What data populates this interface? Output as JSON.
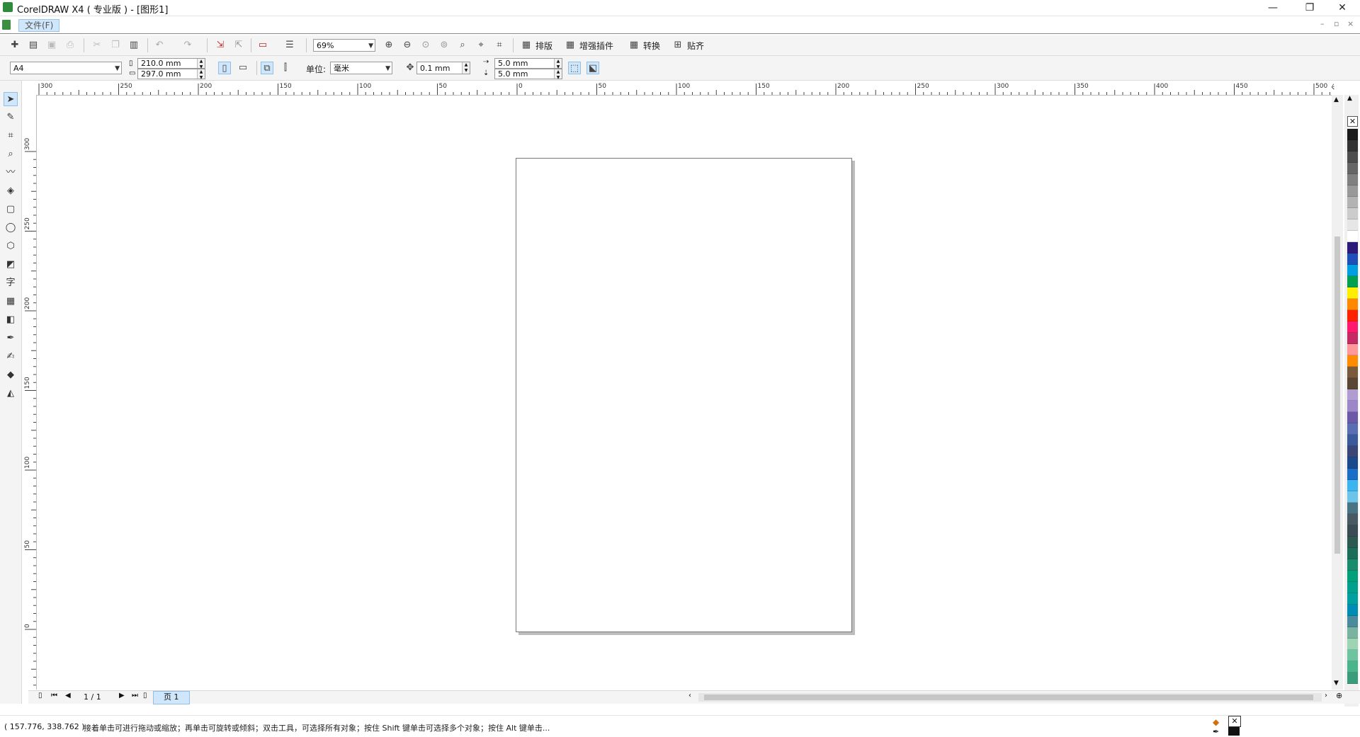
{
  "window": {
    "title": "CorelDRAW X4 ( 专业版 ) - [图形1]",
    "controls": {
      "minimize": "—",
      "restore": "❐",
      "close": "✕"
    }
  },
  "menubar": {
    "file_menu": "文件(F)",
    "mdi_controls": {
      "minimize": "–",
      "restore": "▫",
      "close": "×"
    }
  },
  "toolbar1": {
    "zoom_level": "69%",
    "buttons": {
      "arrange": "排版",
      "enhance_plugins": "增强插件",
      "convert": "转换",
      "align": "贴齐"
    }
  },
  "toolbar2": {
    "paper_size": "A4",
    "width": "210.0 mm",
    "height": "297.0 mm",
    "units_label": "单位:",
    "units_value": "毫米",
    "nudge": "0.1 mm",
    "duplicate_x": "5.0 mm",
    "duplicate_y": "5.0 mm"
  },
  "ruler": {
    "unit_label": "毫米",
    "h_labels": [
      "300",
      "250",
      "200",
      "150",
      "100",
      "50",
      "0",
      "50",
      "100",
      "150",
      "200",
      "250",
      "300",
      "350",
      "400",
      "450",
      "500"
    ],
    "v_labels": [
      "300",
      "250",
      "200",
      "150",
      "100",
      "50",
      "0"
    ]
  },
  "page_nav": {
    "page_count": "1 / 1",
    "tab_label": "页 1"
  },
  "statusbar": {
    "coords": "( 157.776, 338.762 )",
    "hint": "接着单击可进行拖动或缩放；再单击可旋转或倾斜；双击工具，可选择所有对象；按住 Shift 键单击可选择多个对象；按住 Alt 键单击..."
  },
  "palette": [
    "#1a1a1a",
    "#333333",
    "#4d4d4d",
    "#666666",
    "#808080",
    "#999999",
    "#b3b3b3",
    "#cccccc",
    "#e6e6e6",
    "#ffffff",
    "#2e1a7a",
    "#1f4fb8",
    "#00a0e0",
    "#00a050",
    "#ffee00",
    "#ff8800",
    "#ff2200",
    "#ff1a6e",
    "#c42a64",
    "#ff9999",
    "#ff8c00",
    "#7a5a3a",
    "#5a4632",
    "#b09cd0",
    "#9c88c8",
    "#6c5aa8",
    "#5a6eb4",
    "#3a5a9c",
    "#3a4678",
    "#1a4a8c",
    "#1a6ec8",
    "#3cb4f0",
    "#6cc4e8",
    "#4a7484",
    "#4a5a64",
    "#3a4c54",
    "#2c5a50",
    "#1a6e5a",
    "#1a8c6e",
    "#00a07a",
    "#00a08c",
    "#00a0a0",
    "#008cb4",
    "#4a8c9c",
    "#7ab4a0",
    "#9cd4b4",
    "#6cc4a0",
    "#4ab48c",
    "#3a9c7a"
  ]
}
